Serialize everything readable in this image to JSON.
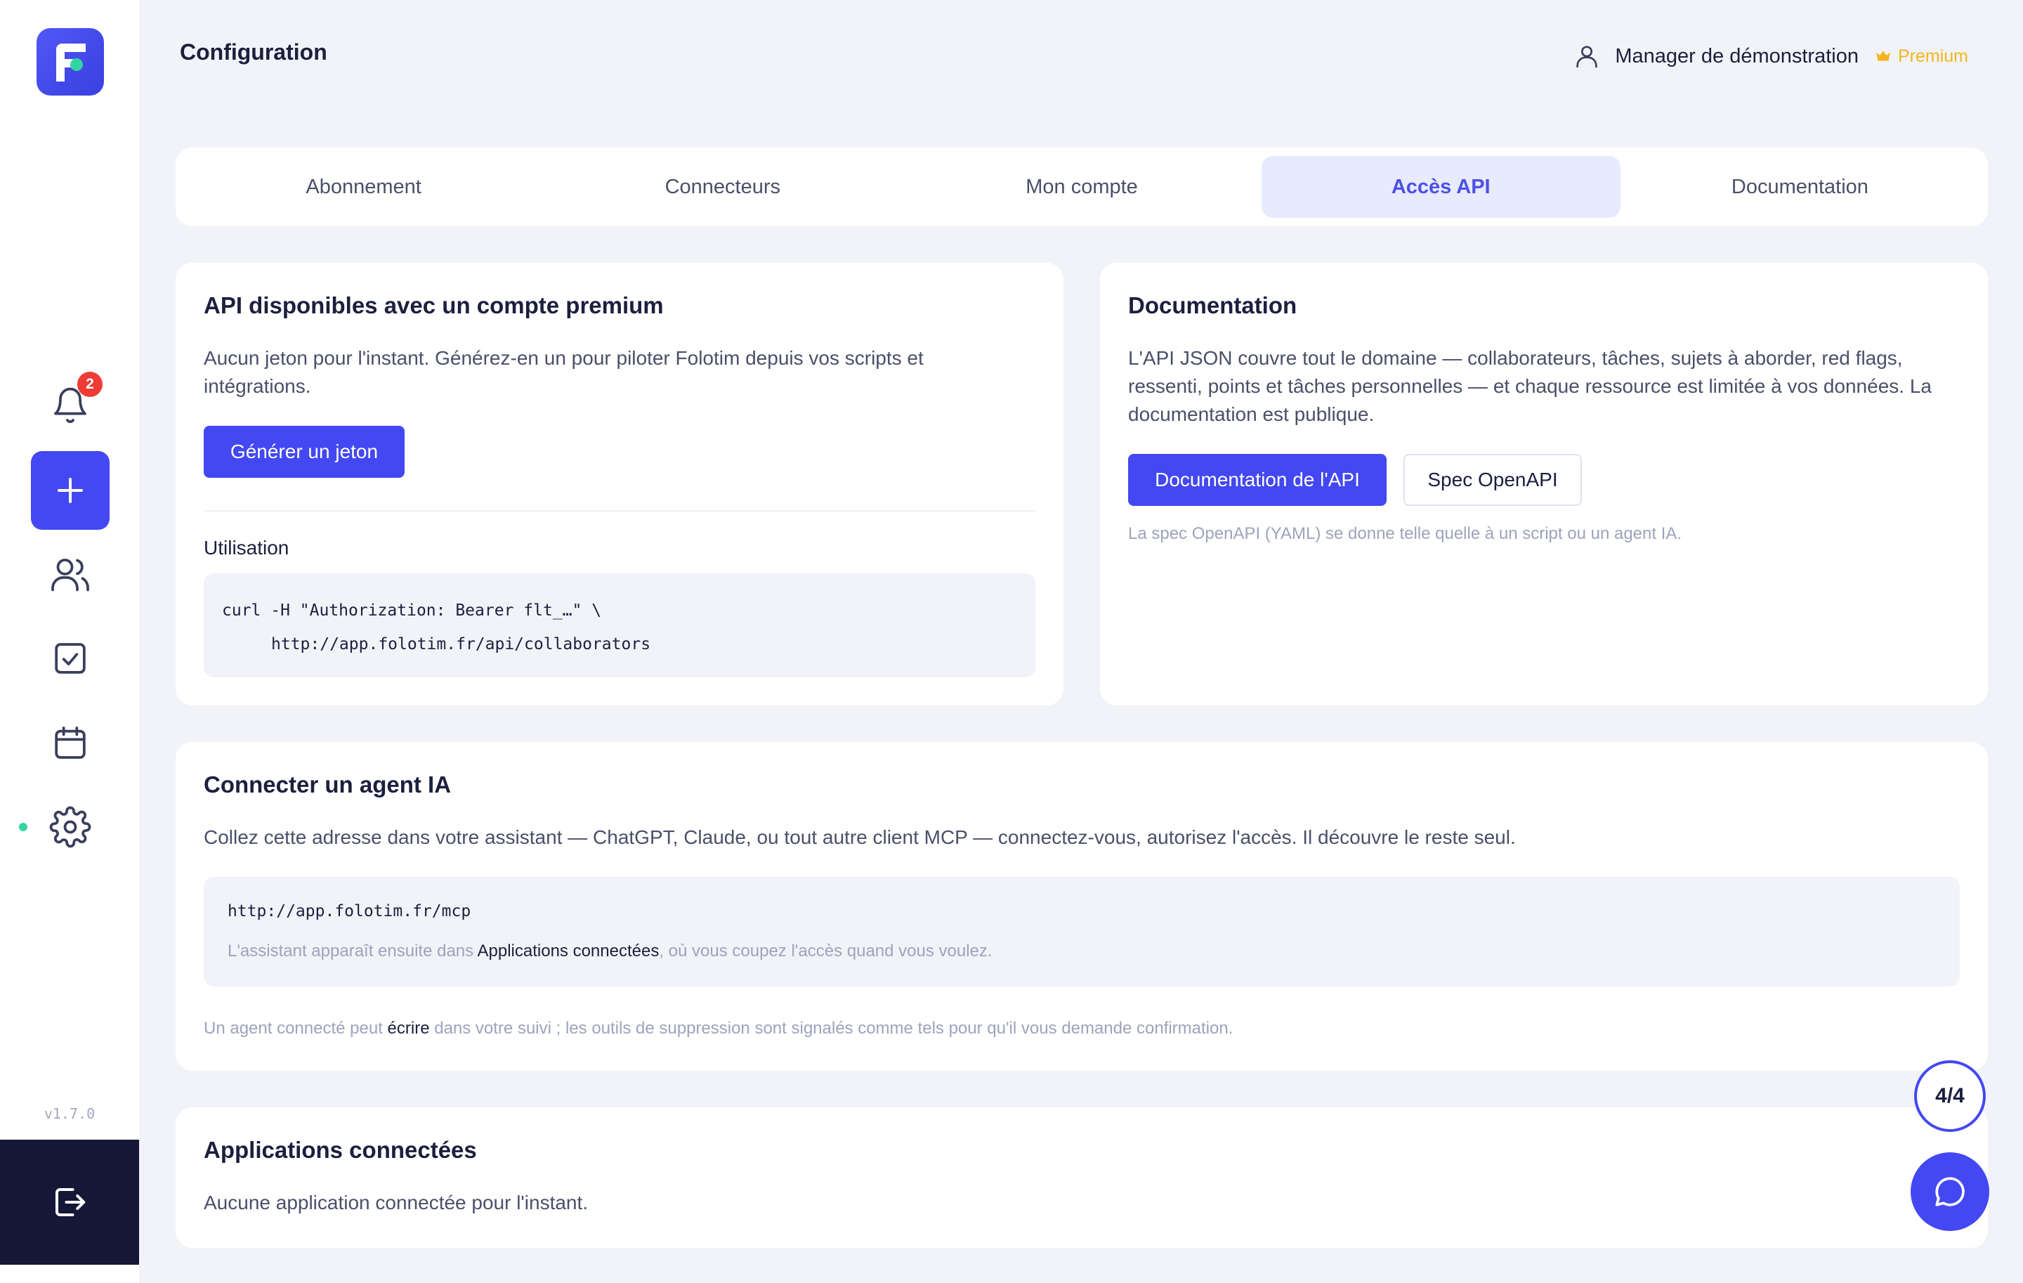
{
  "app": {
    "version": "v1.7.0"
  },
  "sidebar": {
    "notifications_count": "2"
  },
  "header": {
    "title": "Configuration",
    "user_name": "Manager de démonstration",
    "plan_badge": "Premium"
  },
  "tabs": [
    {
      "label": "Abonnement"
    },
    {
      "label": "Connecteurs"
    },
    {
      "label": "Mon compte"
    },
    {
      "label": "Accès API",
      "active": true
    },
    {
      "label": "Documentation"
    }
  ],
  "api_card": {
    "title": "API disponibles avec un compte premium",
    "description": "Aucun jeton pour l'instant. Générez-en un pour piloter Folotim depuis vos scripts et intégrations.",
    "generate_button": "Générer un jeton",
    "usage_title": "Utilisation",
    "code_line1": "curl -H \"Authorization: Bearer flt_…\" \\",
    "code_line2": "http://app.folotim.fr/api/collaborators"
  },
  "doc_card": {
    "title": "Documentation",
    "description": "L'API JSON couvre tout le domaine — collaborateurs, tâches, sujets à aborder, red flags, ressenti, points et tâches personnelles — et chaque ressource est limitée à vos données. La documentation est publique.",
    "doc_button": "Documentation de l'API",
    "spec_button": "Spec OpenAPI",
    "note": "La spec OpenAPI (YAML) se donne telle quelle à un script ou un agent IA."
  },
  "agent_card": {
    "title": "Connecter un agent IA",
    "description": "Collez cette adresse dans votre assistant — ChatGPT, Claude, ou tout autre client MCP — connectez-vous, autorisez l'accès. Il découvre le reste seul.",
    "mcp_url": "http://app.folotim.fr/mcp",
    "note_prefix": "L'assistant apparaît ensuite dans ",
    "note_link": "Applications connectées",
    "note_suffix": ", où vous coupez l'accès quand vous voulez.",
    "warning_prefix": "Un agent connecté peut ",
    "warning_strong": "écrire",
    "warning_suffix": " dans votre suivi ; les outils de suppression sont signalés comme tels pour qu'il vous demande confirmation."
  },
  "apps_card": {
    "title": "Applications connectées",
    "empty": "Aucune application connectée pour l'instant."
  },
  "floating": {
    "step": "4/4"
  }
}
